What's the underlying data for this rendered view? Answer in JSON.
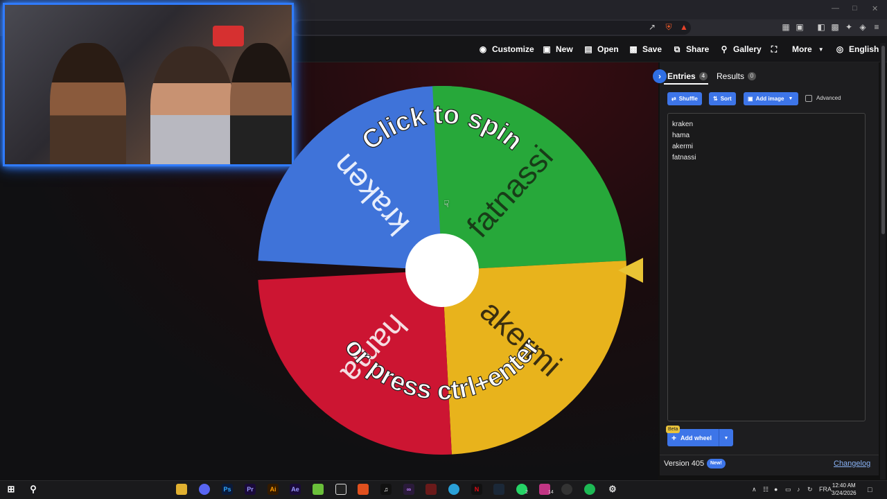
{
  "toolbar": {
    "customize": "Customize",
    "new": "New",
    "open": "Open",
    "save": "Save",
    "share": "Share",
    "gallery": "Gallery",
    "more": "More",
    "language": "English"
  },
  "wheel": {
    "segments": [
      {
        "label": "kraken",
        "color": "#3f73d9"
      },
      {
        "label": "fatnassi",
        "color": "#27a83a"
      },
      {
        "label": "akermi",
        "color": "#e8b31c"
      },
      {
        "label": "hama",
        "color": "#cc1532"
      }
    ],
    "prompt_top": "Click to spin",
    "prompt_bottom": "or press ctrl+enter"
  },
  "panel": {
    "tab_entries": "Entries",
    "entries_count": "4",
    "tab_results": "Results",
    "results_count": "0",
    "shuffle": "Shuffle",
    "sort": "Sort",
    "add_image": "Add image",
    "advanced": "Advanced",
    "entries": [
      "kraken",
      "hama",
      "akermi",
      "fatnassi"
    ],
    "beta": "Beta",
    "add_wheel": "Add wheel",
    "version": "Version 405",
    "new_badge": "New!",
    "changelog": "Changelog"
  },
  "taskbar": {
    "language": "FRA",
    "time": "12:40 AM",
    "date": "3/24/2026",
    "whatsapp_badge": "2",
    "instagram_badge": "14"
  },
  "colors": {
    "accent": "#3d75e8",
    "webcam_border": "#2f7bff",
    "pointer": "#e8c435"
  }
}
